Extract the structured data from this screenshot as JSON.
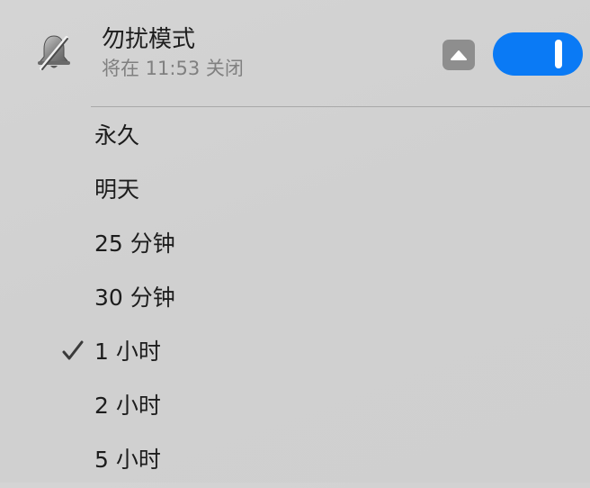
{
  "header": {
    "icon": "bell-slash-icon",
    "title": "勿扰模式",
    "subtitle": "将在 11:53 关闭",
    "expand_icon": "chevron-up-icon",
    "toggle_on": true,
    "accent_color": "#0a7af5"
  },
  "menu": {
    "items": [
      {
        "label": "永久",
        "checked": false
      },
      {
        "label": "明天",
        "checked": false
      },
      {
        "label": "25 分钟",
        "checked": false
      },
      {
        "label": "30 分钟",
        "checked": false
      },
      {
        "label": "1 小时",
        "checked": true
      },
      {
        "label": "2 小时",
        "checked": false
      },
      {
        "label": "5 小时",
        "checked": false
      }
    ],
    "check_icon": "checkmark-icon"
  }
}
